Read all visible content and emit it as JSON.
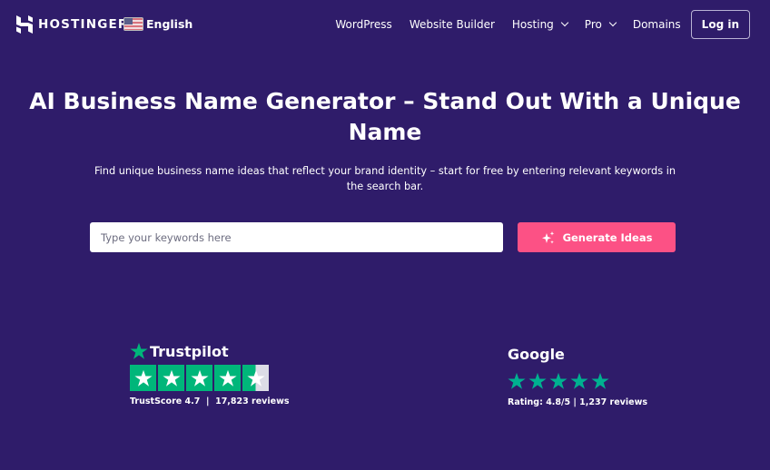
{
  "nav": {
    "brand": "HOSTINGER",
    "language": "English",
    "items": [
      {
        "label": "WordPress",
        "dropdown": false
      },
      {
        "label": "Website Builder",
        "dropdown": false
      },
      {
        "label": "Hosting",
        "dropdown": true
      },
      {
        "label": "Pro",
        "dropdown": true
      },
      {
        "label": "Domains",
        "dropdown": false
      }
    ],
    "login": "Log in"
  },
  "hero": {
    "title": "AI Business Name Generator – Stand Out With a Unique Name",
    "subtitle": "Find unique business name ideas that reflect your brand identity – start for free by entering relevant keywords in the search bar.",
    "search_placeholder": "Type your keywords here",
    "search_value": "",
    "button": "Generate Ideas"
  },
  "reviews": {
    "trustpilot": {
      "name": "Trustpilot",
      "score_text": "TrustScore 4.7",
      "count_text": "17,823 reviews",
      "stars": 4.5
    },
    "google": {
      "name": "Google",
      "rating_text": "Rating: 4.8/5 | 1,237 reviews",
      "stars": 5
    }
  },
  "colors": {
    "background": "#2f1c6a",
    "accent": "#fc5185",
    "trustpilot_green": "#00b67a",
    "google_star": "#00b090"
  }
}
